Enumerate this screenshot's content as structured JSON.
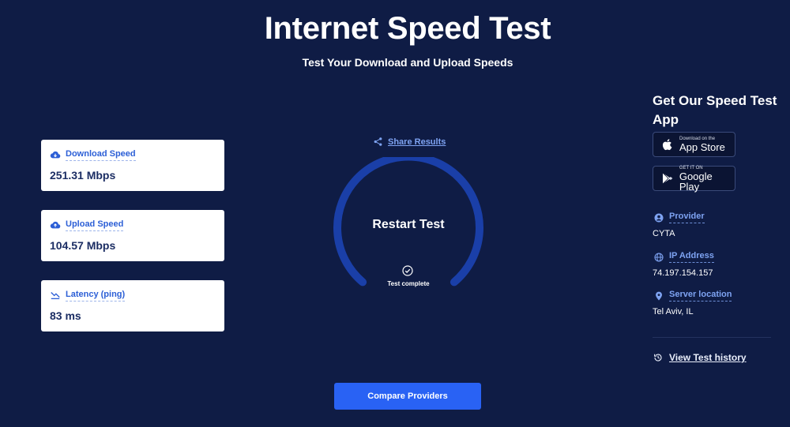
{
  "header": {
    "title": "Internet Speed Test",
    "subtitle": "Test Your Download and Upload Speeds"
  },
  "metrics": [
    {
      "label": "Download Speed",
      "value": "251.31 Mbps",
      "icon": "cloud-download-icon"
    },
    {
      "label": "Upload Speed",
      "value": "104.57 Mbps",
      "icon": "cloud-upload-icon"
    },
    {
      "label": "Latency (ping)",
      "value": "83 ms",
      "icon": "latency-icon"
    }
  ],
  "center": {
    "share_label": "Share Results",
    "restart_label": "Restart Test",
    "status_label": "Test complete",
    "compare_label": "Compare Providers"
  },
  "sidebar": {
    "app_title": "Get Our Speed Test App",
    "app_store": {
      "small": "Download on the",
      "big": "App Store"
    },
    "google_play": {
      "small": "GET IT ON",
      "big": "Google Play"
    },
    "provider": {
      "label": "Provider",
      "value": "CYTA"
    },
    "ip": {
      "label": "IP Address",
      "value": "74.197.154.157"
    },
    "server": {
      "label": "Server location",
      "value": "Tel Aviv, IL"
    },
    "history_label": "View Test history"
  },
  "colors": {
    "background": "#0f1c45",
    "accent": "#2962f4",
    "link": "#7ea3f2",
    "gauge": "#1a3fa8"
  }
}
